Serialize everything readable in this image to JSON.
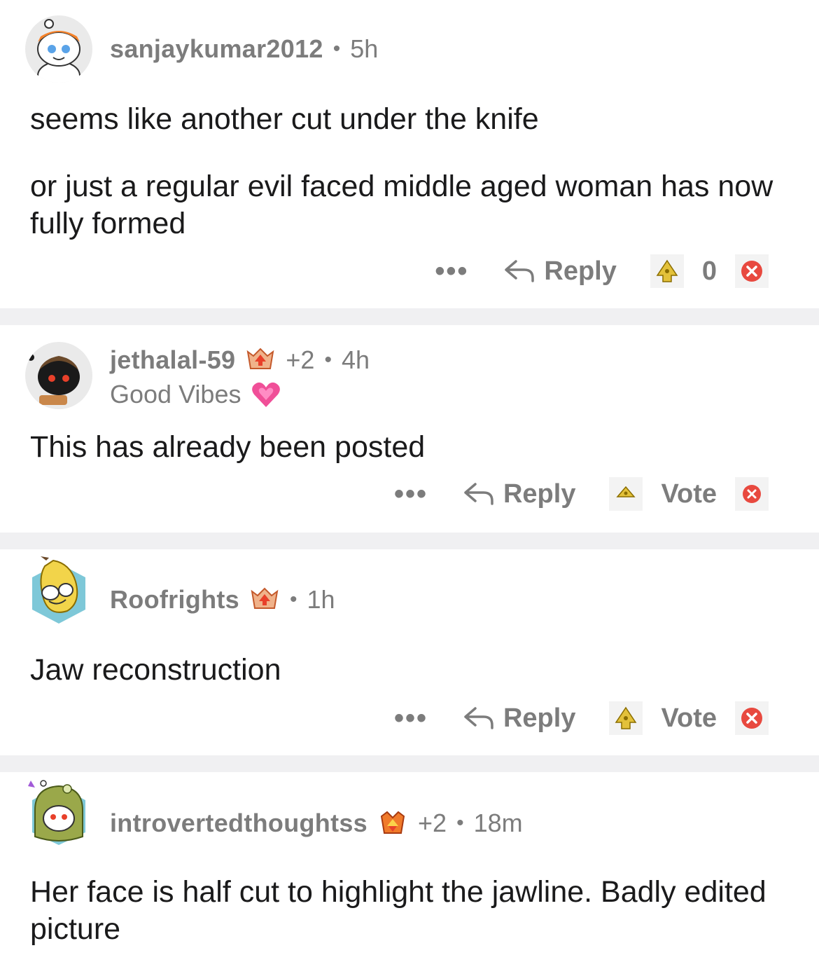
{
  "comments": [
    {
      "username": "sanjaykumar2012",
      "time": "5h",
      "paragraphs": [
        "seems like another cut under the knife",
        "or just  a regular evil faced middle aged woman has now fully formed"
      ],
      "more_label": "•••",
      "reply_label": "Reply",
      "vote_label": "0",
      "avatar_icon": "snoo-bandana-avatar"
    },
    {
      "username": "jethalal-59",
      "plus": "+2",
      "time": "4h",
      "flair": "Good Vibes",
      "flair_icon": "growing-heart-icon",
      "paragraphs": [
        "This has already been posted"
      ],
      "more_label": "•••",
      "reply_label": "Reply",
      "vote_label": "Vote",
      "avatar_icon": "dark-snoo-avatar"
    },
    {
      "username": "Roofrights",
      "time": "1h",
      "paragraphs": [
        "Jaw reconstruction"
      ],
      "more_label": "•••",
      "reply_label": "Reply",
      "vote_label": "Vote",
      "avatar_icon": "banana-snoo-avatar"
    },
    {
      "username": "introvertedthoughtss",
      "plus": "+2",
      "time": "18m",
      "paragraphs": [
        "Her face is half cut to highlight the jawline. Badly edited picture"
      ],
      "avatar_icon": "frog-hood-snoo-avatar"
    }
  ],
  "colors": {
    "meta": "#7c7c7c",
    "text": "#1a1a1b",
    "separator": "#f0f0f2",
    "downvote": "#e8493f",
    "upvote_gold": "#e3c13a"
  }
}
